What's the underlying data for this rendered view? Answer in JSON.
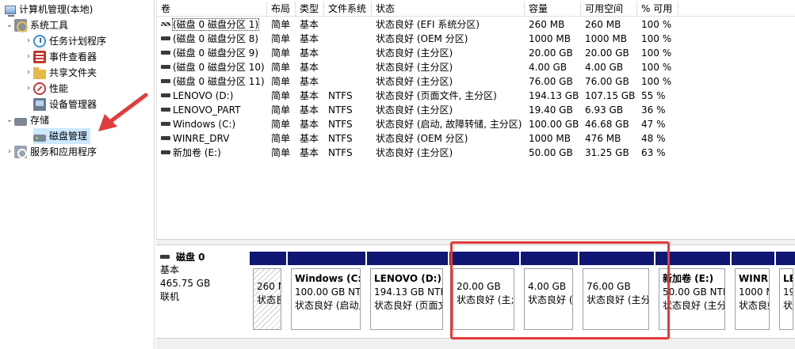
{
  "tree": {
    "root": "计算机管理(本地)",
    "system_tools": "系统工具",
    "task_scheduler": "任务计划程序",
    "event_viewer": "事件查看器",
    "shared_folders": "共享文件夹",
    "performance": "性能",
    "device_manager": "设备管理器",
    "storage": "存储",
    "disk_management": "磁盘管理",
    "services_apps": "服务和应用程序"
  },
  "volume_table": {
    "columns": [
      "卷",
      "布局",
      "类型",
      "文件系统",
      "状态",
      "容量",
      "可用空间",
      "% 可用"
    ],
    "rows": [
      {
        "name": "(磁盘 0 磁盘分区 1)",
        "layout": "简单",
        "type": "基本",
        "fs": "",
        "status": "状态良好 (EFI 系统分区)",
        "capacity": "260 MB",
        "free": "260 MB",
        "pct": "100 %",
        "icon": "hatched-volume-icon"
      },
      {
        "name": "(磁盘 0 磁盘分区 8)",
        "layout": "简单",
        "type": "基本",
        "fs": "",
        "status": "状态良好 (OEM 分区)",
        "capacity": "1000 MB",
        "free": "1000 MB",
        "pct": "100 %",
        "icon": "volume-icon"
      },
      {
        "name": "(磁盘 0 磁盘分区 9)",
        "layout": "简单",
        "type": "基本",
        "fs": "",
        "status": "状态良好 (主分区)",
        "capacity": "20.00 GB",
        "free": "20.00 GB",
        "pct": "100 %",
        "icon": "volume-icon"
      },
      {
        "name": "(磁盘 0 磁盘分区 10)",
        "layout": "简单",
        "type": "基本",
        "fs": "",
        "status": "状态良好 (主分区)",
        "capacity": "4.00 GB",
        "free": "4.00 GB",
        "pct": "100 %",
        "icon": "volume-icon"
      },
      {
        "name": "(磁盘 0 磁盘分区 11)",
        "layout": "简单",
        "type": "基本",
        "fs": "",
        "status": "状态良好 (主分区)",
        "capacity": "76.00 GB",
        "free": "76.00 GB",
        "pct": "100 %",
        "icon": "volume-icon"
      },
      {
        "name": "LENOVO (D:)",
        "layout": "简单",
        "type": "基本",
        "fs": "NTFS",
        "status": "状态良好 (页面文件, 主分区)",
        "capacity": "194.13 GB",
        "free": "107.15 GB",
        "pct": "55 %",
        "icon": "volume-icon"
      },
      {
        "name": "LENOVO_PART",
        "layout": "简单",
        "type": "基本",
        "fs": "NTFS",
        "status": "状态良好 (主分区)",
        "capacity": "19.40 GB",
        "free": "6.93 GB",
        "pct": "36 %",
        "icon": "volume-icon"
      },
      {
        "name": "Windows (C:)",
        "layout": "简单",
        "type": "基本",
        "fs": "NTFS",
        "status": "状态良好 (启动, 故障转储, 主分区)",
        "capacity": "100.00 GB",
        "free": "46.68 GB",
        "pct": "47 %",
        "icon": "volume-icon"
      },
      {
        "name": "WINRE_DRV",
        "layout": "简单",
        "type": "基本",
        "fs": "NTFS",
        "status": "状态良好 (OEM 分区)",
        "capacity": "1000 MB",
        "free": "476 MB",
        "pct": "48 %",
        "icon": "volume-icon"
      },
      {
        "name": "新加卷 (E:)",
        "layout": "简单",
        "type": "基本",
        "fs": "NTFS",
        "status": "状态良好 (主分区)",
        "capacity": "50.00 GB",
        "free": "31.25 GB",
        "pct": "63 %",
        "icon": "volume-icon"
      }
    ]
  },
  "disk": {
    "name": "磁盘 0",
    "kind": "基本",
    "size": "465.75 GB",
    "state": "联机"
  },
  "partitions": [
    {
      "name": "",
      "size": "260 M",
      "status": "状态良好",
      "hatched": true
    },
    {
      "name": "Windows (C:)",
      "size": "100.00 GB NTF",
      "status": "状态良好 (启动,",
      "hatched": false
    },
    {
      "name": "LENOVO (D:)",
      "size": "194.13 GB NTFS",
      "status": "状态良好 (页面文",
      "hatched": false
    },
    {
      "name": "",
      "size": "20.00 GB",
      "status": "状态良好 (主;",
      "hatched": false
    },
    {
      "name": "",
      "size": "4.00 GB",
      "status": "状态良好 (",
      "hatched": false
    },
    {
      "name": "",
      "size": "76.00 GB",
      "status": "状态良好 (主分|",
      "hatched": false
    },
    {
      "name": "新加卷 (E:)",
      "size": "50.00 GB NTF",
      "status": "状态良好 (主分",
      "hatched": false
    },
    {
      "name": "WINRE_",
      "size": "1000 M",
      "status": "状态良好",
      "hatched": false
    },
    {
      "name": "LE",
      "size": "19",
      "status": "状",
      "hatched": false
    }
  ],
  "colors": {
    "partition_bar": "#0f1673",
    "selection": "#cce8ff",
    "annotation": "#e23b3b"
  }
}
